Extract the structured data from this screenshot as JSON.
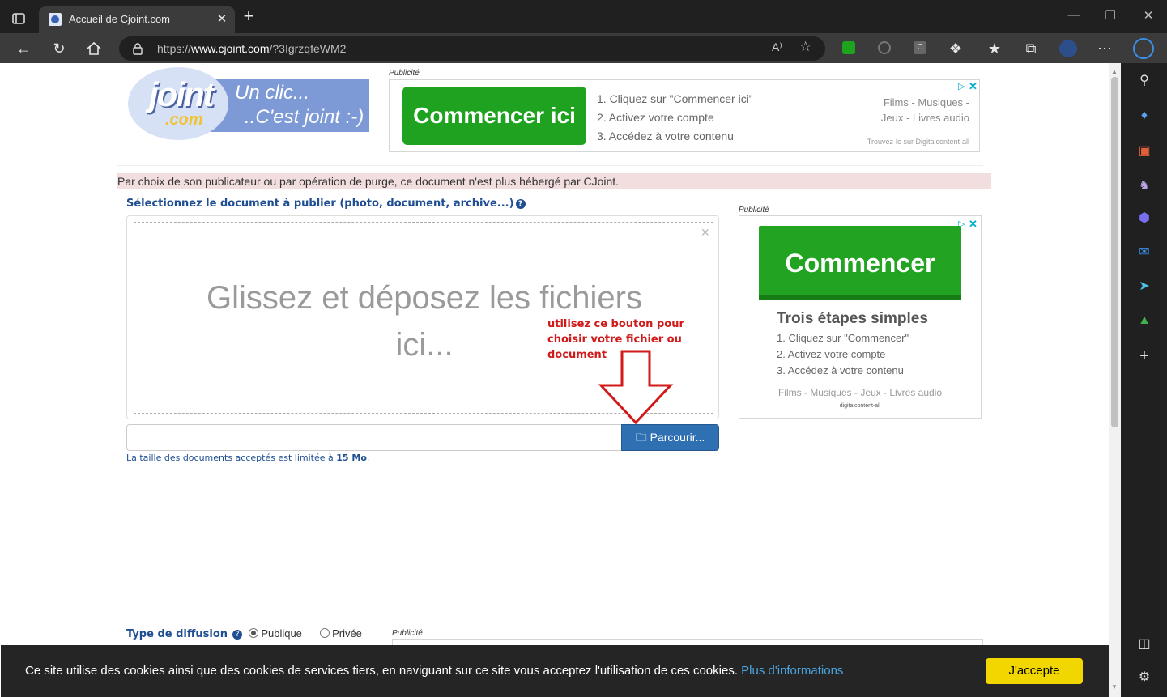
{
  "browser": {
    "tab_title": "Accueil de Cjoint.com",
    "url_prefix": "https://",
    "url_host": "www.cjoint.com",
    "url_path": "/?3IgrzqfeWM2",
    "read_aloud": "A⁾",
    "new_tab": "+",
    "tab_close": "✕"
  },
  "logo": {
    "brand_top": "joint",
    "brand_bottom": ".com",
    "tagline_1": "Un clic...",
    "tagline_2": "..C'est joint :-)"
  },
  "ad_top": {
    "label": "Publicité",
    "cta": "Commencer ici",
    "step_1": "1. Cliquez sur \"Commencer ici\"",
    "step_2": "2. Activez votre compte",
    "step_3": "3. Accédez à votre contenu",
    "right_1": "Films - Musiques -",
    "right_2": "Jeux - Livres audio",
    "source": "Trouvez-le sur Digitalcontent-all"
  },
  "notice": "Par choix de son publicateur ou par opération de purge, ce document n'est plus hébergé par CJoint.",
  "upload": {
    "select_label": "Sélectionnez le document à publier (photo, document, archive...)",
    "help_icon": "?",
    "dropzone_line1": "Glissez et déposez les fichiers",
    "dropzone_line2": "ici...",
    "dropzone_close": "×",
    "annotation": "utilisez ce bouton pour choisir votre fichier ou document",
    "file_value": "",
    "browse_label": "Parcourir...",
    "size_note_prefix": "La taille des documents acceptés est limitée à ",
    "size_note_limit": "15 Mo",
    "size_note_suffix": "."
  },
  "ad_right": {
    "label": "Publicité",
    "cta": "Commencer",
    "title": "Trois étapes simples",
    "step_1": "1. Cliquez sur \"Commencer\"",
    "step_2": "2. Activez votre compte",
    "step_3": "3. Accédez à votre contenu",
    "categories": "Films - Musiques - Jeux - Livres audio",
    "brand": "digitalcontent-all"
  },
  "diffusion": {
    "label": "Type de diffusion",
    "option_public": "Publique",
    "option_private": "Privée",
    "selected": "Publique",
    "ad_label": "Publicité"
  },
  "cookie": {
    "message": "Ce site utilise des cookies ainsi que des cookies de services tiers, en naviguant sur ce site vous acceptez l'utilisation de ces cookies. ",
    "more_link": "Plus d'informations",
    "accept": "J'accepte"
  },
  "colors": {
    "accent_blue": "#1f4f92",
    "ad_green": "#1fa21f",
    "notice_bg": "#f2dede",
    "annotation_red": "#d11a1a",
    "cookie_button": "#f1d600"
  }
}
